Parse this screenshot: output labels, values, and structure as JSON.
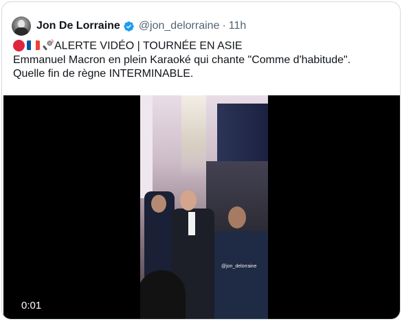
{
  "tweet": {
    "author_name": "Jon De Lorraine",
    "handle": "@jon_delorraine",
    "separator": "·",
    "time": "11h",
    "text_line1": "ALERTE VIDÉO | TOURNÉE EN ASIE",
    "text_line2": "Emmanuel Macron en plein Karaoké qui chante \"Comme d'habitude\".",
    "text_line3": "Quelle fin de règne INTERMINABLE.",
    "emojis": [
      "red-circle-icon",
      "france-flag-icon",
      "microphone-icon"
    ]
  },
  "video": {
    "watermark": "@jon_delorraine",
    "timestamp": "0:01"
  },
  "colors": {
    "verified_blue": "#1d9bf0",
    "secondary_text": "#536471",
    "border": "#cfd9de"
  }
}
